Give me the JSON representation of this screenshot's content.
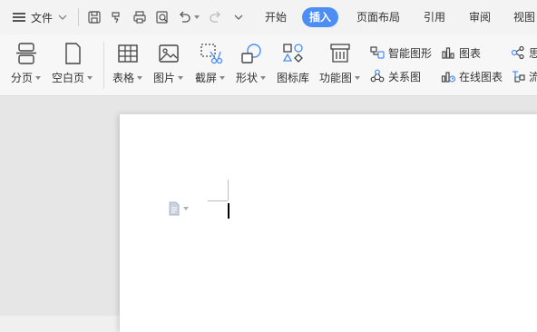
{
  "menubar": {
    "file_label": "文件",
    "tabs": [
      {
        "label": "开始",
        "active": false
      },
      {
        "label": "插入",
        "active": true
      },
      {
        "label": "页面布局",
        "active": false
      },
      {
        "label": "引用",
        "active": false
      },
      {
        "label": "审阅",
        "active": false
      },
      {
        "label": "视图",
        "active": false
      }
    ],
    "quick_access": [
      "save-icon",
      "format-painter-icon",
      "print-icon",
      "print-preview-icon",
      "undo-icon",
      "redo-icon",
      "customize-chevron-icon"
    ],
    "accent_color": "#4d8ef5"
  },
  "ribbon": {
    "page_break": "分页",
    "blank_page": "空白页",
    "table": "表格",
    "picture": "图片",
    "screenshot": "截屏",
    "shape": "形状",
    "icon_library": "图标库",
    "function_chart": "功能图",
    "smart_graphic": "智能图形",
    "relation_chart": "关系图",
    "chart": "图表",
    "online_chart": "在线图表",
    "truncated_top": "思",
    "truncated_bottom": "流"
  }
}
